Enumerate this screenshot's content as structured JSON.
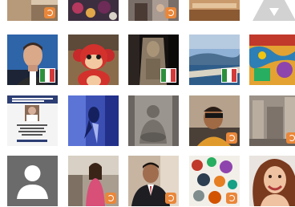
{
  "page": {
    "title": ""
  },
  "grid": {
    "rows": [
      {
        "tiles": [
          {
            "name": "tile-1-1",
            "kind": "partial-photo-orange-badge",
            "badge": "orange"
          },
          {
            "name": "tile-1-2",
            "kind": "partial-photo-flowers",
            "badge": "none"
          },
          {
            "name": "tile-1-3",
            "kind": "partial-photo-people-orange-badge",
            "badge": "orange"
          },
          {
            "name": "tile-1-4",
            "kind": "partial-photo-landscape",
            "badge": "none"
          },
          {
            "name": "tile-1-5",
            "kind": "partial-placeholder-icon",
            "badge": "none"
          }
        ]
      },
      {
        "tiles": [
          {
            "name": "tile-2-1",
            "kind": "portrait-man",
            "badge": "flag"
          },
          {
            "name": "tile-2-2",
            "kind": "red-monkey-plush",
            "badge": "none"
          },
          {
            "name": "tile-2-3",
            "kind": "statue",
            "badge": "flag"
          },
          {
            "name": "tile-2-4",
            "kind": "coastal-landscape",
            "badge": "flag"
          },
          {
            "name": "tile-2-5",
            "kind": "colorful-painting",
            "badge": "none"
          }
        ]
      },
      {
        "tiles": [
          {
            "name": "tile-3-1",
            "kind": "id-badge-document",
            "badge": "none"
          },
          {
            "name": "tile-3-2",
            "kind": "blue-bird-painting",
            "badge": "none"
          },
          {
            "name": "tile-3-3",
            "kind": "buddha-statue",
            "badge": "none"
          },
          {
            "name": "tile-3-4",
            "kind": "person-sunglasses",
            "badge": "orange"
          },
          {
            "name": "tile-3-5",
            "kind": "stone-ruins",
            "badge": "orange"
          }
        ]
      },
      {
        "tiles": [
          {
            "name": "tile-4-1",
            "kind": "default-avatar",
            "badge": "none"
          },
          {
            "name": "tile-4-2",
            "kind": "woman-street",
            "badge": "orange"
          },
          {
            "name": "tile-4-3",
            "kind": "man-suit",
            "badge": "orange"
          },
          {
            "name": "tile-4-4",
            "kind": "floral-collage",
            "badge": "orange"
          },
          {
            "name": "tile-4-5",
            "kind": "woman-curly-hair",
            "badge": "none"
          }
        ]
      }
    ]
  },
  "colors": {
    "badge_orange": "#e9873a",
    "avatar_bg": "#6b6b6b",
    "avatar_fg": "#ffffff"
  }
}
